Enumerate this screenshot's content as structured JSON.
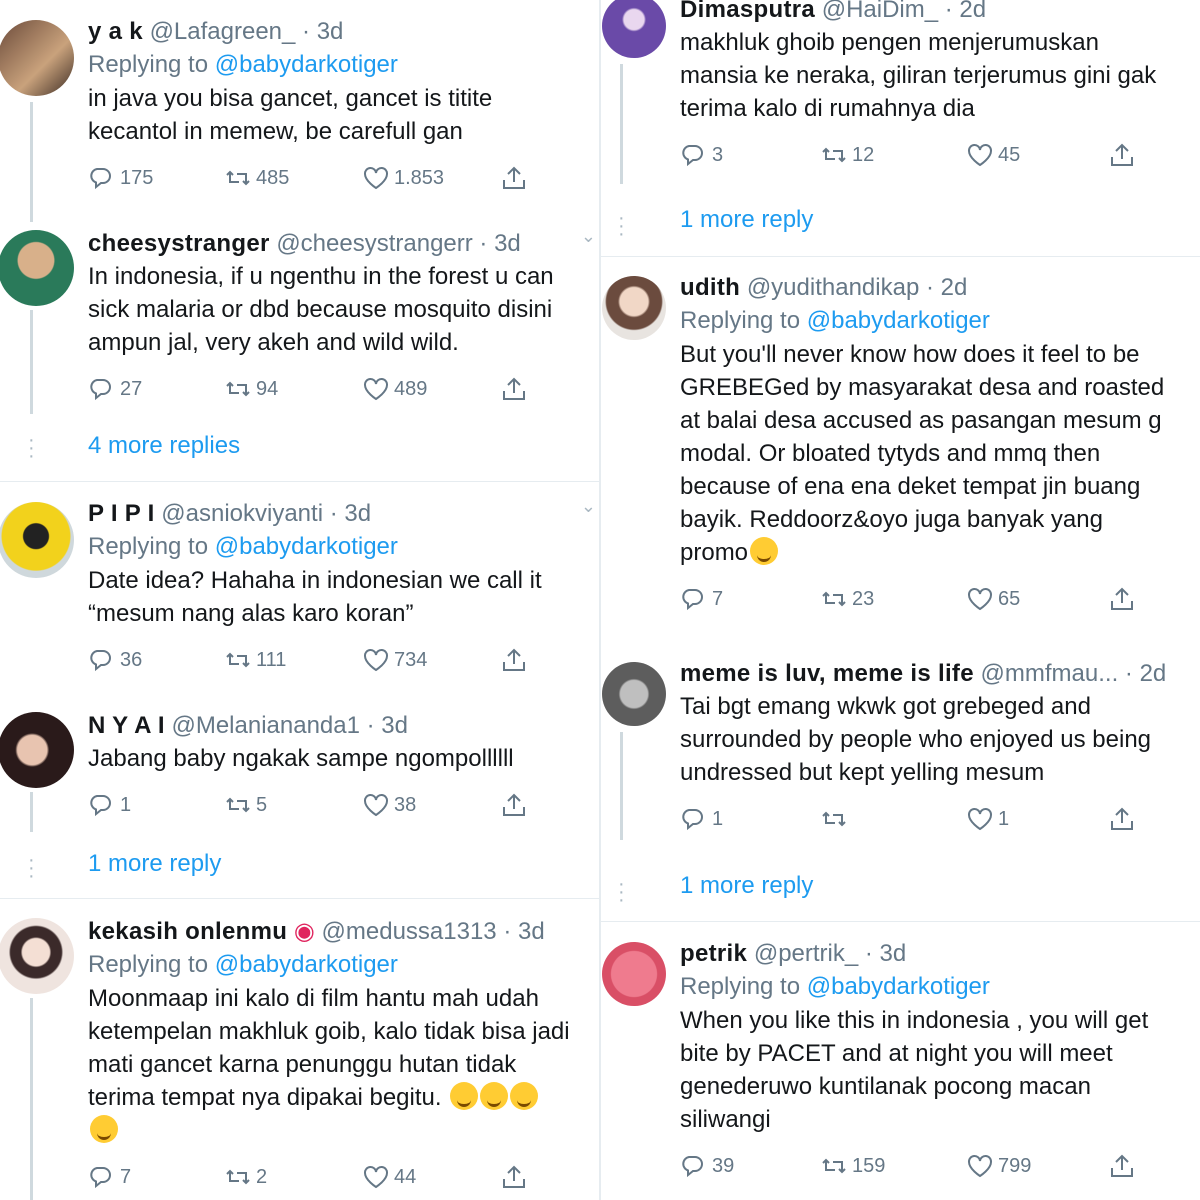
{
  "left": {
    "tweets": [
      {
        "name": "y a k",
        "handle": "@Lafagreen_ · 3d",
        "replying_label": "Replying to",
        "replying_to": "@babydarkotiger",
        "lines": [
          "in java you bisa gancet, gancet is titite",
          "kecantol in memew, be carefull gan"
        ],
        "replies": "175",
        "retweets": "485",
        "likes": "1.853"
      },
      {
        "name": "cheesystranger",
        "handle": "@cheesystrangerr · 3d",
        "lines": [
          "In indonesia, if u ngenthu in the forest u can",
          "sick malaria or dbd because mosquito disini",
          "ampun jal,  very akeh and wild wild."
        ],
        "replies": "27",
        "retweets": "94",
        "likes": "489",
        "more": "4 more replies"
      },
      {
        "name": "P I P I",
        "handle": "@asniokviyanti · 3d",
        "replying_label": "Replying to",
        "replying_to": "@babydarkotiger",
        "lines": [
          "Date idea? Hahaha in indonesian we call it",
          "“mesum nang alas karo koran”"
        ],
        "replies": "36",
        "retweets": "111",
        "likes": "734"
      },
      {
        "name": "N Y A I",
        "handle": "@Melaniananda1 · 3d",
        "lines": [
          "Jabang baby ngakak sampe ngompollllll"
        ],
        "replies": "1",
        "retweets": "5",
        "likes": "38",
        "more": "1 more reply"
      },
      {
        "name": "kekasih onlenmu",
        "handle": "@medussa1313 · 3d",
        "replying_label": "Replying to",
        "replying_to": "@babydarkotiger",
        "lines": [
          "Moonmaap ini kalo di film hantu mah udah",
          "ketempelan makhluk goib, kalo tidak bisa jadi",
          "mati gancet karna penunggu hutan tidak",
          "terima tempat nya dipakai begitu."
        ],
        "replies": "7",
        "retweets": "2",
        "likes": "44"
      }
    ]
  },
  "right": {
    "tweets": [
      {
        "name": "Dimasputra",
        "handle": "@HaiDim_ · 2d",
        "lines": [
          "makhluk ghoib pengen menjerumuskan",
          "mansia ke neraka, giliran terjerumus gini gak",
          "terima kalo di rumahnya dia"
        ],
        "replies": "3",
        "retweets": "12",
        "likes": "45",
        "more": "1 more reply"
      },
      {
        "name": "udith",
        "handle": "@yudithandikap · 2d",
        "replying_label": "Replying to",
        "replying_to": "@babydarkotiger",
        "lines": [
          "But you'll never know how does it feel to be",
          "GREBEGed by masyarakat desa and roasted",
          "at balai desa accused as pasangan mesum g",
          "modal. Or bloated tytyds and mmq then",
          "because of ena ena deket tempat jin buang",
          "bayik. Reddoorz&oyo juga banyak yang",
          "promo"
        ],
        "replies": "7",
        "retweets": "23",
        "likes": "65"
      },
      {
        "name": "meme is luv, meme is life",
        "handle": "@mmfmau... · 2d",
        "lines": [
          "Tai bgt emang wkwk got grebeged and",
          "surrounded by people who enjoyed us being",
          "undressed but kept yelling mesum"
        ],
        "replies": "1",
        "retweets": "",
        "likes": "1",
        "more": "1 more reply"
      },
      {
        "name": "petrik",
        "handle": "@pertrik_ · 3d",
        "replying_label": "Replying to",
        "replying_to": "@babydarkotiger",
        "lines": [
          "When you like this in indonesia , you will get",
          "bite by PACET and at night you will meet",
          "genederuwo kuntilanak pocong macan",
          "siliwangi"
        ],
        "replies": "39",
        "retweets": "159",
        "likes": "799"
      }
    ]
  },
  "icons": {
    "reply": "reply-icon",
    "retweet": "retweet-icon",
    "like": "heart-icon",
    "share": "share-icon"
  },
  "colors": {
    "link": "#1d9bf0",
    "muted": "#657786",
    "text": "#14171a"
  }
}
